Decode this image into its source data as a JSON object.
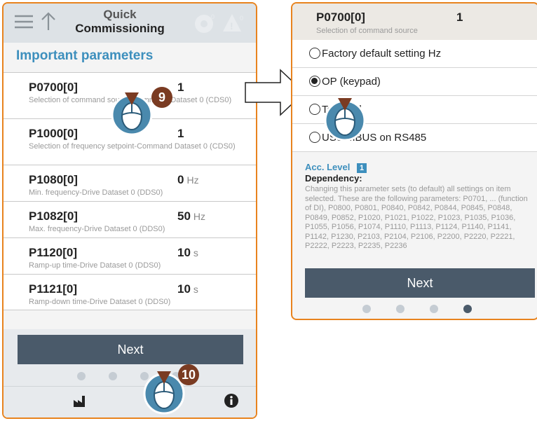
{
  "left": {
    "header_title_line1": "Quick",
    "header_title_line2": "Commissioning",
    "section_title": "Important parameters",
    "params": [
      {
        "code": "P0700[0]",
        "value": "1",
        "unit": "",
        "desc": "Selection of command source-Command Dataset 0 (CDS0)"
      },
      {
        "code": "P1000[0]",
        "value": "1",
        "unit": "",
        "desc": "Selection of frequency setpoint-Command Dataset 0 (CDS0)"
      },
      {
        "code": "P1080[0]",
        "value": "0",
        "unit": "Hz",
        "desc": "Min. frequency-Drive Dataset 0 (DDS0)"
      },
      {
        "code": "P1082[0]",
        "value": "50",
        "unit": "Hz",
        "desc": "Max. frequency-Drive Dataset 0 (DDS0)"
      },
      {
        "code": "P1120[0]",
        "value": "10",
        "unit": "s",
        "desc": "Ramp-up time-Drive Dataset 0 (DDS0)"
      },
      {
        "code": "P1121[0]",
        "value": "10",
        "unit": "s",
        "desc": "Ramp-down time-Drive Dataset 0 (DDS0)"
      }
    ],
    "next_label": "Next",
    "badge_step_a": "9",
    "badge_step_b": "10"
  },
  "right": {
    "param_code": "P0700[0]",
    "param_value": "1",
    "param_desc": "Selection of command source",
    "options": [
      {
        "label": "Factory default setting Hz",
        "checked": false
      },
      {
        "label": "OP (keypad)",
        "checked": true
      },
      {
        "label": "Terminal",
        "checked": false
      },
      {
        "label": "USS/MBUS on RS485",
        "checked": false
      }
    ],
    "acc_level_label": "Acc. Level",
    "acc_level_value": "1",
    "dependency_label": "Dependency:",
    "dependency_text": "Changing this parameter sets (to default) all settings on item selected. These are the following parameters: P0701, ... (function of DI), P0800, P0801, P0840, P0842, P0844, P0845, P0848, P0849, P0852, P1020, P1021, P1022, P1023, P1035, P1036, P1055, P1056, P1074, P1110, P1113, P1124, P1140, P1141, P1142, P1230, P2103, P2104, P2106, P2200, P2220, P2221, P2222, P2223, P2235, P2236",
    "next_label": "Next"
  },
  "colors": {
    "accent_orange": "#e8831e",
    "title_blue": "#3d8fbd",
    "button_dark": "#4a5a6a",
    "badge_brown": "#7a3b22"
  },
  "icons": [
    "menu-icon",
    "up-arrow-icon",
    "settings-warning-icon",
    "warning-icon",
    "factory-icon",
    "info-icon",
    "mouse-cursor-icon",
    "right-arrow-icon"
  ]
}
